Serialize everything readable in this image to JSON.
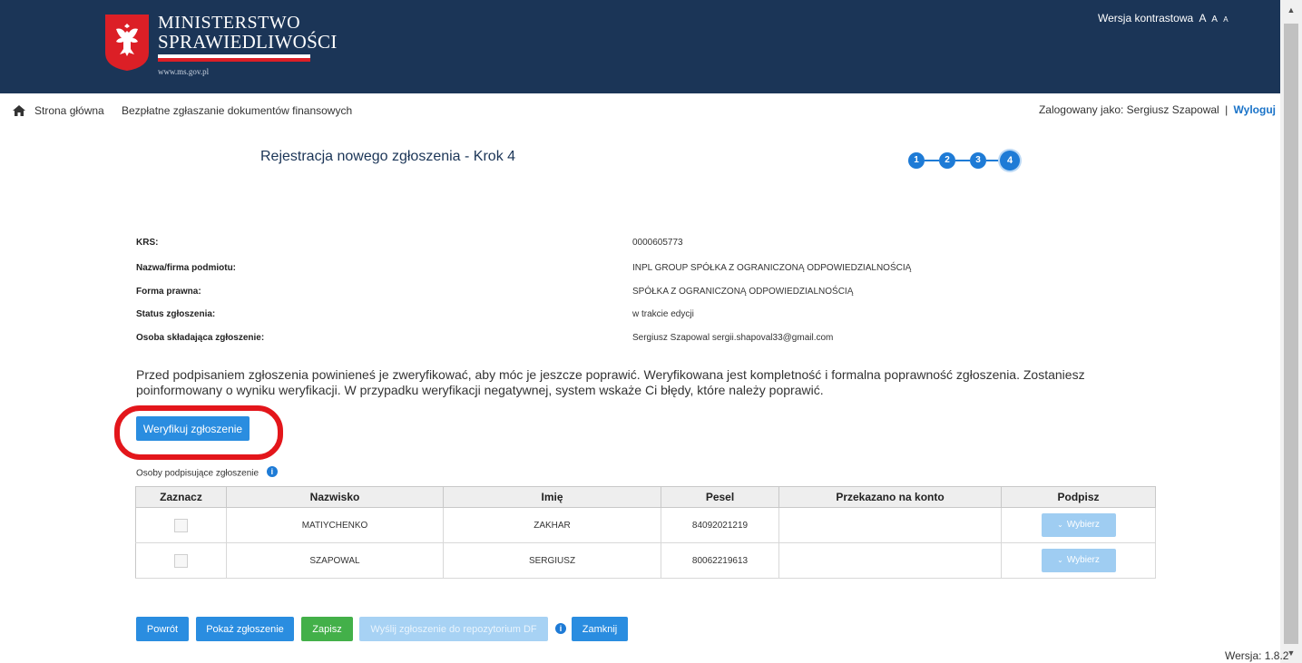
{
  "header": {
    "logo_line1": "MINISTERSTWO",
    "logo_line2": "SPRAWIEDLIWOŚCI",
    "logo_url": "www.ms.gov.pl",
    "contrast_label": "Wersja kontrastowa",
    "font_sizes": [
      "A",
      "A",
      "A"
    ],
    "colors": {
      "background": "#1b3557",
      "logo_red": "#dc1f26"
    }
  },
  "breadcrumb": {
    "home": "Strona główna",
    "current": "Bezpłatne zgłaszanie dokumentów finansowych"
  },
  "login": {
    "prefix": "Zalogowany jako:",
    "user": "Sergiusz Szapowal",
    "separator": "|",
    "logout": "Wyloguj"
  },
  "page_title": "Rejestracja nowego zgłoszenia - Krok 4",
  "steps": [
    "1",
    "2",
    "3",
    "4"
  ],
  "active_step": 4,
  "info": [
    {
      "label": "KRS:",
      "value": "0000605773"
    },
    {
      "label": "Nazwa/firma podmiotu:",
      "value": "INPL GROUP SPÓŁKA Z OGRANICZONĄ ODPOWIEDZIALNOŚCIĄ"
    },
    {
      "label": "Forma prawna:",
      "value": "SPÓŁKA Z OGRANICZONĄ ODPOWIEDZIALNOŚCIĄ"
    },
    {
      "label": "Status zgłoszenia:",
      "value": "w trakcie edycji"
    },
    {
      "label": "Osoba składająca zgłoszenie:",
      "value": "Sergiusz Szapowal sergii.shapoval33@gmail.com"
    }
  ],
  "notice": "Przed podpisaniem zgłoszenia powinieneś je zweryfikować, aby móc je jeszcze poprawić. Weryfikowana jest kompletność i formalna poprawność zgłoszenia. Zostaniesz poinformowany o wyniku weryfikacji. W przypadku weryfikacji negatywnej, system wskaże Ci błędy, które należy poprawić.",
  "verify_button": "Weryfikuj zgłoszenie",
  "signers_label": "Osoby podpisujące zgłoszenie",
  "info_glyph": "i",
  "table": {
    "headers": [
      "Zaznacz",
      "Nazwisko",
      "Imię",
      "Pesel",
      "Przekazano na konto",
      "Podpisz"
    ],
    "rows": [
      {
        "nazwisko": "MATIYCHENKO",
        "imie": "ZAKHAR",
        "pesel": "84092021219",
        "przekazano": "",
        "podpisz": "Wybierz"
      },
      {
        "nazwisko": "SZAPOWAL",
        "imie": "SERGIUSZ",
        "pesel": "80062219613",
        "przekazano": "",
        "podpisz": "Wybierz"
      }
    ]
  },
  "buttons": {
    "back": "Powrót",
    "show": "Pokaż zgłoszenie",
    "save": "Zapisz",
    "send": "Wyślij zgłoszenie do repozytorium DF",
    "close": "Zamknij"
  },
  "icons": [
    "home-icon",
    "info-icon",
    "chevron-down-icon",
    "scroll-up-icon",
    "scroll-down-icon"
  ],
  "version": "Wersja: 1.8.2"
}
